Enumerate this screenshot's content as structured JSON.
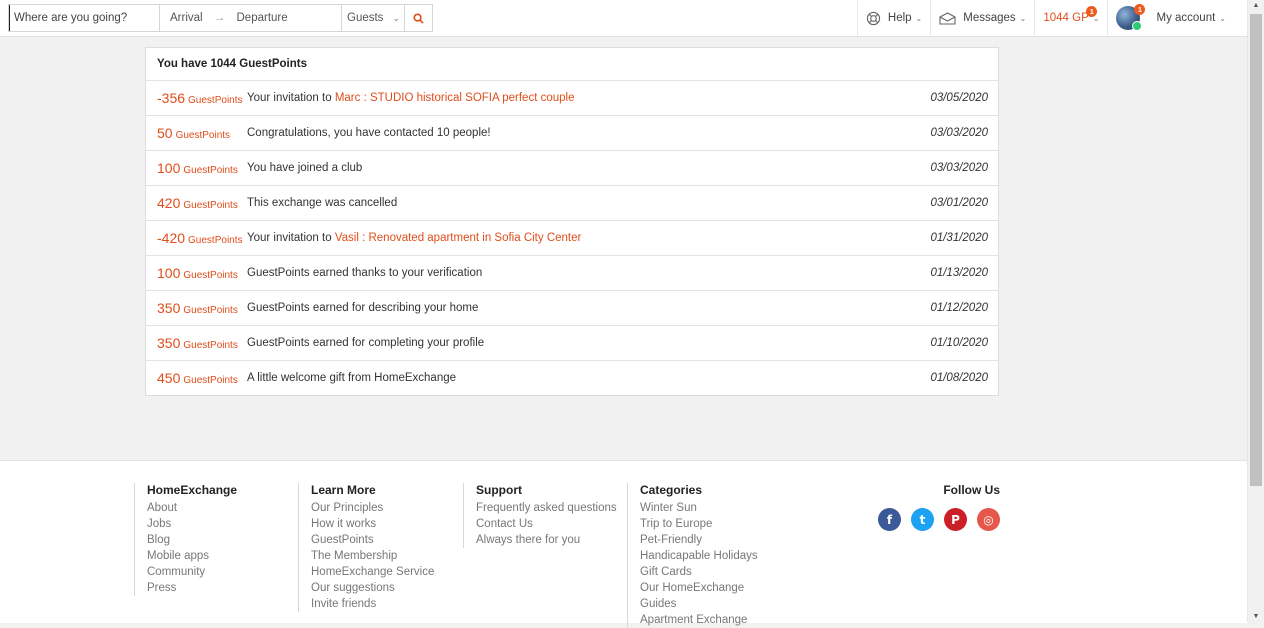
{
  "search": {
    "destination_placeholder": "Where are you going?",
    "arrival": "Arrival",
    "arrow": "→",
    "departure": "Departure",
    "guests": "Guests"
  },
  "nav": {
    "help": "Help",
    "messages": "Messages",
    "gp": "1044 GP",
    "gp_badge": "1",
    "account": "My account",
    "account_badge": "1"
  },
  "card": {
    "title": "You have 1044 GuestPoints",
    "unit": "GuestPoints",
    "rows": [
      {
        "amount": "-356",
        "text": "Your invitation to ",
        "link": "Marc : STUDIO historical SOFIA perfect couple",
        "date": "03/05/2020"
      },
      {
        "amount": "50",
        "text": "Congratulations, you have contacted 10 people!",
        "link": "",
        "date": "03/03/2020"
      },
      {
        "amount": "100",
        "text": "You have joined a club",
        "link": "",
        "date": "03/03/2020"
      },
      {
        "amount": "420",
        "text": "This exchange was cancelled",
        "link": "",
        "date": "03/01/2020"
      },
      {
        "amount": "-420",
        "text": "Your invitation to ",
        "link": "Vasil : Renovated apartment in Sofia City Center",
        "date": "01/31/2020"
      },
      {
        "amount": "100",
        "text": "GuestPoints earned thanks to your verification",
        "link": "",
        "date": "01/13/2020"
      },
      {
        "amount": "350",
        "text": "GuestPoints earned for describing your home",
        "link": "",
        "date": "01/12/2020"
      },
      {
        "amount": "350",
        "text": "GuestPoints earned for completing your profile",
        "link": "",
        "date": "01/10/2020"
      },
      {
        "amount": "450",
        "text": "A little welcome gift from HomeExchange",
        "link": "",
        "date": "01/08/2020"
      }
    ]
  },
  "footer": {
    "columns": [
      {
        "title": "HomeExchange",
        "links": [
          "About",
          "Jobs",
          "Blog",
          "Mobile apps",
          "Community",
          "Press"
        ]
      },
      {
        "title": "Learn More",
        "links": [
          "Our Principles",
          "How it works",
          "GuestPoints",
          "The Membership",
          "HomeExchange Service",
          "Our suggestions",
          "Invite friends"
        ]
      },
      {
        "title": "Support",
        "links": [
          "Frequently asked questions",
          "Contact Us",
          "Always there for you"
        ]
      },
      {
        "title": "Categories",
        "links": [
          "Winter Sun",
          "Trip to Europe",
          "Pet-Friendly",
          "Handicapable Holidays",
          "Gift Cards",
          "Our HomeExchange",
          "Guides",
          "Apartment Exchange"
        ]
      }
    ],
    "follow_title": "Follow Us",
    "social": [
      {
        "icon": "facebook-icon",
        "glyph": "f",
        "color": "#3b5998"
      },
      {
        "icon": "twitter-icon",
        "glyph": "t",
        "color": "#1da1f2"
      },
      {
        "icon": "pinterest-icon",
        "glyph": "P",
        "color": "#cb2027"
      },
      {
        "icon": "instagram-icon",
        "glyph": "◎",
        "color": "#e4574a"
      }
    ]
  },
  "colors": {
    "accent": "#e04e1b"
  }
}
